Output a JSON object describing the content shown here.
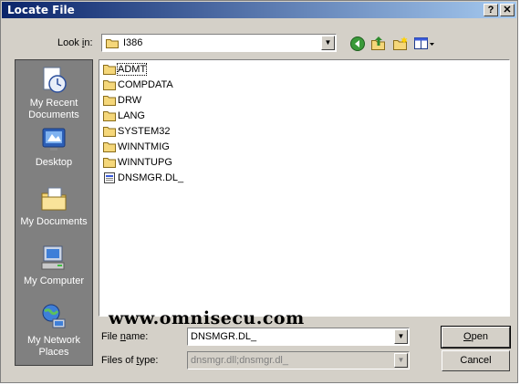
{
  "window": {
    "title": "Locate File"
  },
  "titlebar_buttons": {
    "help": "?",
    "close": "✕"
  },
  "lookin": {
    "label_pre": "Look ",
    "label_u": "i",
    "label_post": "n:",
    "value": "I386"
  },
  "places": [
    {
      "label": "My Recent Documents",
      "icon": "recent-documents-icon"
    },
    {
      "label": "Desktop",
      "icon": "desktop-icon"
    },
    {
      "label": "My Documents",
      "icon": "my-documents-icon"
    },
    {
      "label": "My Computer",
      "icon": "my-computer-icon"
    },
    {
      "label": "My Network Places",
      "icon": "network-places-icon"
    }
  ],
  "files": [
    {
      "name": "ADMT",
      "type": "folder"
    },
    {
      "name": "COMPDATA",
      "type": "folder"
    },
    {
      "name": "DRW",
      "type": "folder"
    },
    {
      "name": "LANG",
      "type": "folder"
    },
    {
      "name": "SYSTEM32",
      "type": "folder"
    },
    {
      "name": "WINNTMIG",
      "type": "folder"
    },
    {
      "name": "WINNTUPG",
      "type": "folder"
    },
    {
      "name": "DNSMGR.DL_",
      "type": "file"
    }
  ],
  "filename": {
    "label_pre": "File ",
    "label_u": "n",
    "label_post": "ame:",
    "value": "DNSMGR.DL_"
  },
  "filetype": {
    "label_pre": "Files of ",
    "label_u": "t",
    "label_post": "ype:",
    "value": "dnsmgr.dll;dnsmgr.dl_"
  },
  "buttons": {
    "open_u": "O",
    "open_rest": "pen",
    "cancel": "Cancel"
  },
  "watermark": "www.omnisecu.com",
  "colors": {
    "titlebar_start": "#0a246a",
    "titlebar_end": "#a6caf0",
    "face": "#d4d0c8",
    "places_bg": "#808080"
  }
}
